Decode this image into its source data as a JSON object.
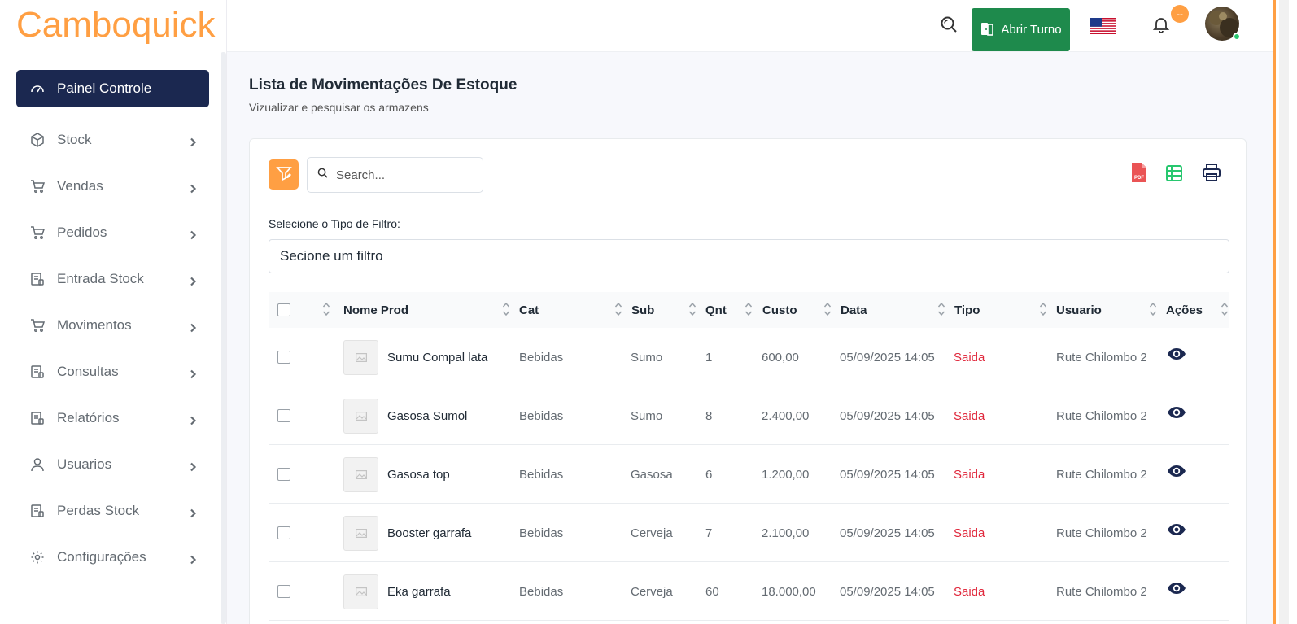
{
  "app": {
    "logo": "Camboquick"
  },
  "sidebar": {
    "items": [
      {
        "label": "Painel Controle",
        "icon": "dashboard-icon",
        "active": true
      },
      {
        "label": "Stock",
        "icon": "box-icon"
      },
      {
        "label": "Vendas",
        "icon": "cart-icon"
      },
      {
        "label": "Pedidos",
        "icon": "cart-icon"
      },
      {
        "label": "Entrada Stock",
        "icon": "document-icon"
      },
      {
        "label": "Movimentos",
        "icon": "cart-icon"
      },
      {
        "label": "Consultas",
        "icon": "document-icon"
      },
      {
        "label": "Relatórios",
        "icon": "document-icon"
      },
      {
        "label": "Usuarios",
        "icon": "user-icon"
      },
      {
        "label": "Perdas Stock",
        "icon": "document-icon"
      },
      {
        "label": "Configurações",
        "icon": "gear-icon"
      }
    ]
  },
  "header": {
    "open_shift_label": "Abrir Turno",
    "notification_badge": "--",
    "colors": {
      "accent": "#ff9f43",
      "shift_button": "#1e8a4c",
      "sidebar_active": "#1b2850"
    }
  },
  "page": {
    "title": "Lista de Movimentações De Estoque",
    "subtitle": "Vizualizar e pesquisar os armazens"
  },
  "toolbar": {
    "search_placeholder": "Search...",
    "filter_label": "Selecione o Tipo de Filtro:",
    "filter_value": "Secione um filtro"
  },
  "table": {
    "columns": [
      "Nome Prod",
      "Cat",
      "Sub",
      "Qnt",
      "Custo",
      "Data",
      "Tipo",
      "Usuario",
      "Ações"
    ],
    "rows": [
      {
        "name": "Sumu Compal lata",
        "cat": "Bebidas",
        "sub": "Sumo",
        "qnt": "1",
        "custo": "600,00",
        "data": "05/09/2025 14:05",
        "tipo": "Saida",
        "usuario": "Rute Chilombo 2"
      },
      {
        "name": "Gasosa Sumol",
        "cat": "Bebidas",
        "sub": "Sumo",
        "qnt": "8",
        "custo": "2.400,00",
        "data": "05/09/2025 14:05",
        "tipo": "Saida",
        "usuario": "Rute Chilombo 2"
      },
      {
        "name": "Gasosa top",
        "cat": "Bebidas",
        "sub": "Gasosa",
        "qnt": "6",
        "custo": "1.200,00",
        "data": "05/09/2025 14:05",
        "tipo": "Saida",
        "usuario": "Rute Chilombo 2"
      },
      {
        "name": "Booster garrafa",
        "cat": "Bebidas",
        "sub": "Cerveja",
        "qnt": "7",
        "custo": "2.100,00",
        "data": "05/09/2025 14:05",
        "tipo": "Saida",
        "usuario": "Rute Chilombo 2"
      },
      {
        "name": "Eka garrafa",
        "cat": "Bebidas",
        "sub": "Cerveja",
        "qnt": "60",
        "custo": "18.000,00",
        "data": "05/09/2025 14:05",
        "tipo": "Saida",
        "usuario": "Rute Chilombo 2"
      }
    ]
  }
}
